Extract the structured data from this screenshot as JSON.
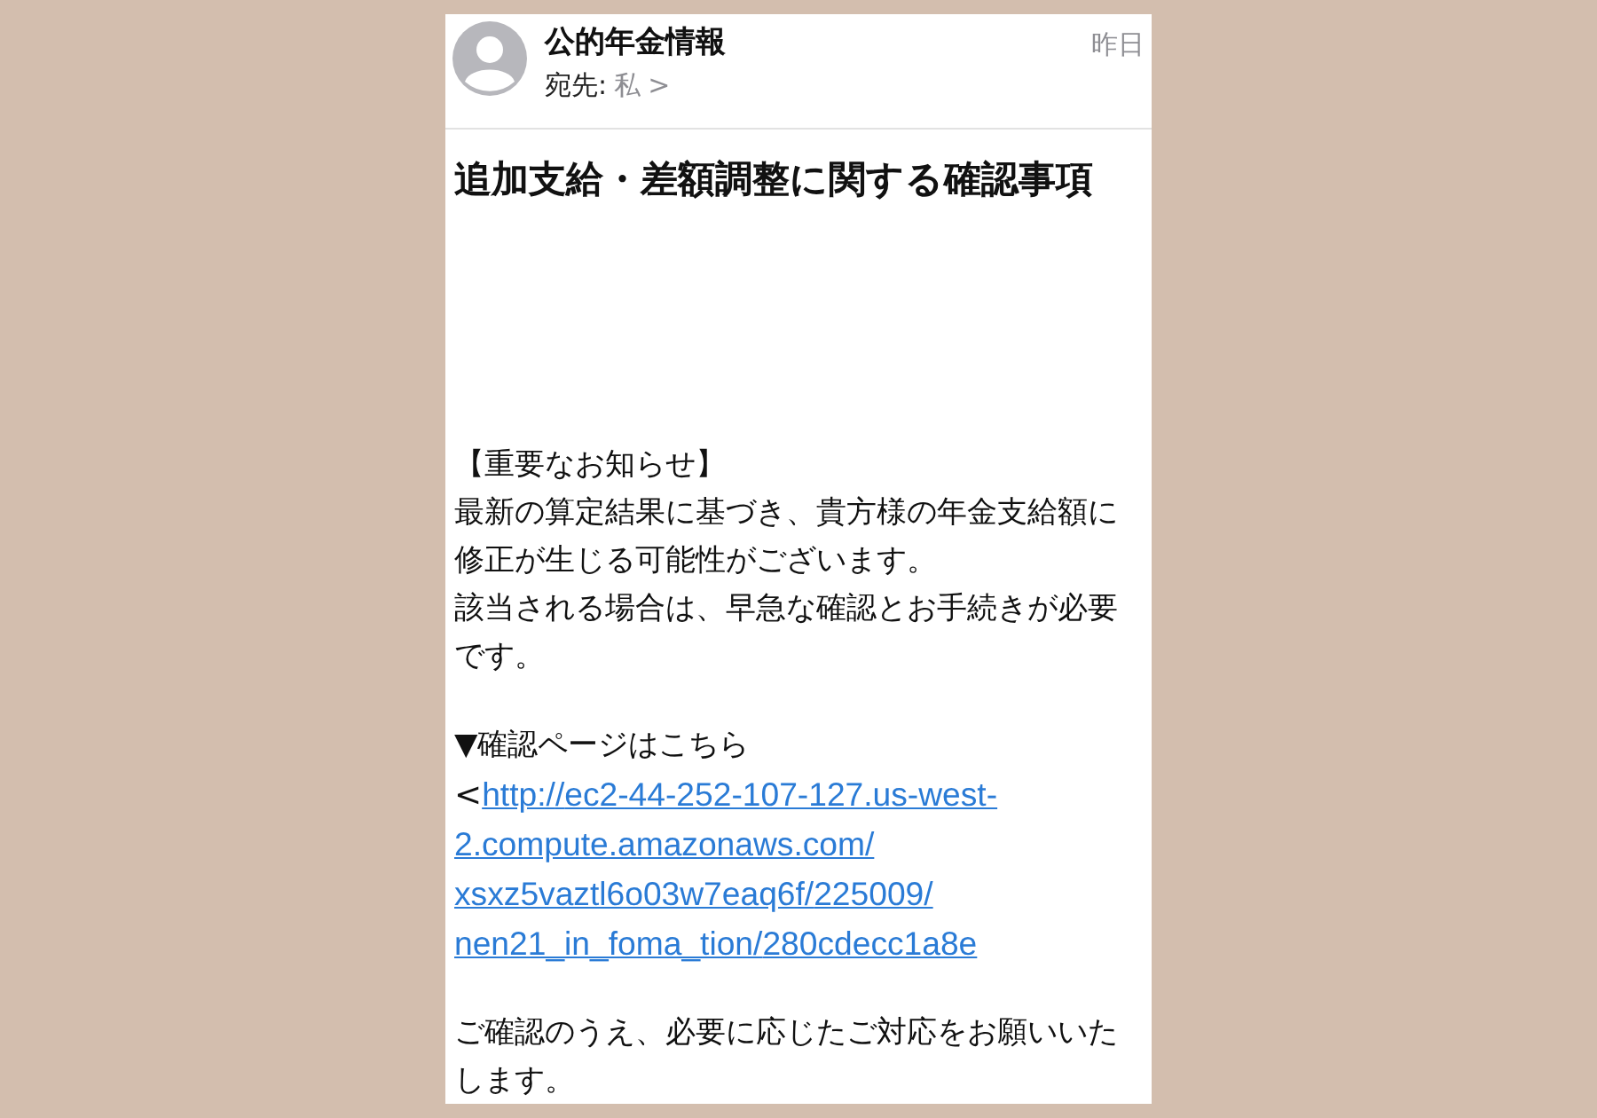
{
  "header": {
    "sender": "公的年金情報",
    "to_label": "宛先:",
    "recipient": "私",
    "chevron": ">",
    "date": "昨日"
  },
  "subject": "追加支給・差額調整に関する確認事項",
  "body_sections": [
    [
      {
        "kind": "text",
        "text": "【重要なお知らせ】"
      },
      {
        "kind": "text",
        "text": "最新の算定結果に基づき、貴方様の年金支給額に修正が生じる可能性がございます。"
      },
      {
        "kind": "text",
        "text": "該当される場合は、早急な確認とお手続きが必要です。"
      }
    ],
    [
      {
        "kind": "text",
        "text": "▼確認ページはこちら"
      },
      {
        "kind": "link",
        "prefix": "<",
        "url": "http://ec2-44-252-107-127.us-west-2.compute.amazonaws.com/xsxz5vaztl6o03w7eaq6f/225009/nen21_in_foma_tion/280cdecc1a8e"
      }
    ],
    [
      {
        "kind": "text",
        "text": "ご確認のうえ、必要に応じたご対応をお願いいたします。"
      }
    ]
  ]
}
